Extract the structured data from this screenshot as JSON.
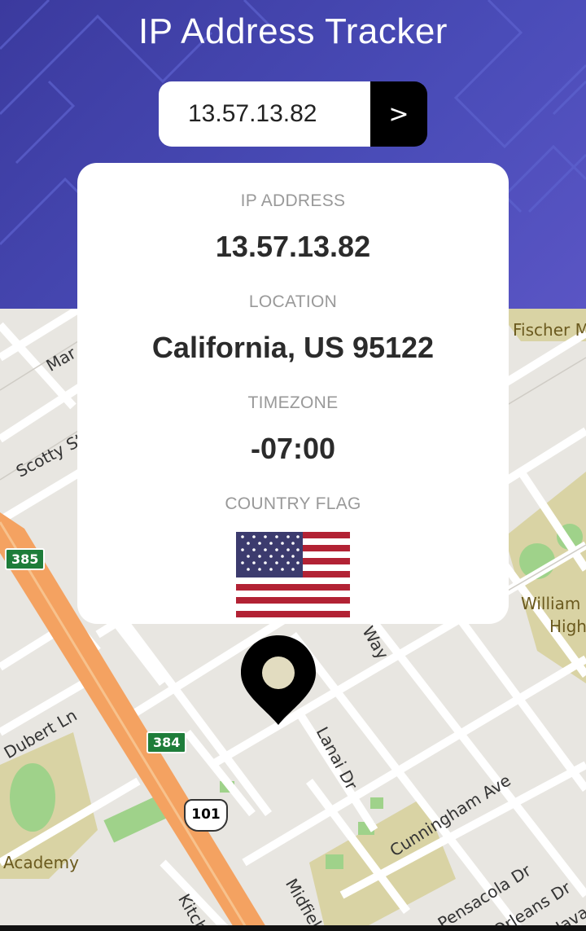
{
  "header": {
    "title": "IP Address Tracker",
    "search_value": "13.57.13.82",
    "submit_label": ">"
  },
  "info": {
    "ip_label": "IP ADDRESS",
    "ip_value": "13.57.13.82",
    "location_label": "LOCATION",
    "location_value": "California, US 95122",
    "timezone_label": "TIMEZONE",
    "timezone_value": "-07:00",
    "flag_label": "COUNTRY FLAG"
  },
  "map": {
    "labels": {
      "fischer": "Fischer M",
      "mar": "Mar",
      "scotty": "Scotty St",
      "william": "William",
      "high": "High",
      "dubert": "Dubert Ln",
      "lanai": "Lanai Dr",
      "cunningham": "Cunningham Ave",
      "academy": "Academy",
      "pensacola": "Pensacola Dr",
      "orleans": "Orleans Dr",
      "kitch": "Kitch",
      "midfield": "Midfiel",
      "way": "Way",
      "navarre": "Navarr"
    },
    "shields": {
      "r385": "385",
      "r384": "384",
      "us101": "101"
    }
  },
  "colors": {
    "header_bg": "#4a4cb8",
    "highway": "#f4a261",
    "park": "#d9d3a4",
    "green": "#9fd28a"
  }
}
